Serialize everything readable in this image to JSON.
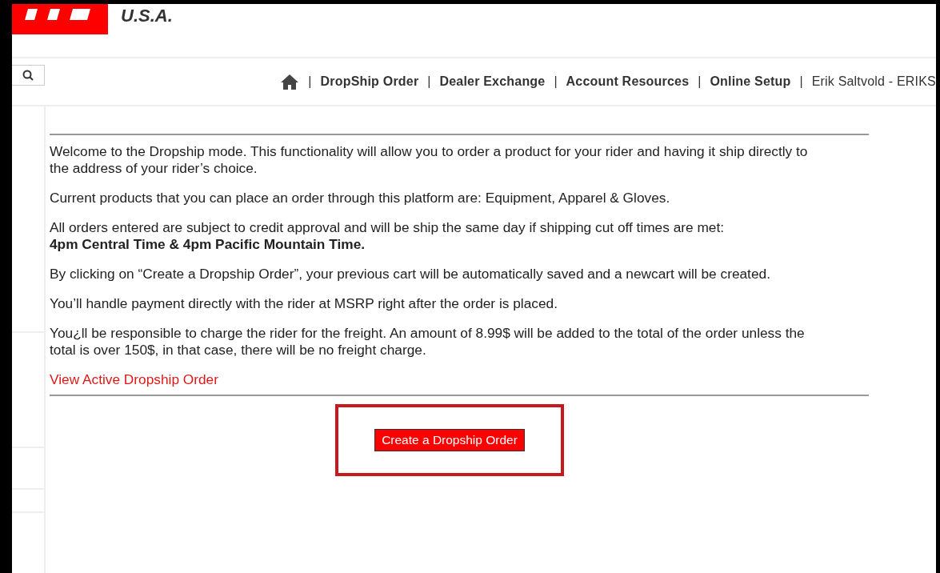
{
  "header": {
    "region": "U.S.A."
  },
  "nav": {
    "separator": "|",
    "items": [
      {
        "label": "DropShip Order",
        "kind": "link"
      },
      {
        "label": "Dealer Exchange",
        "kind": "link"
      },
      {
        "label": "Account Resources",
        "kind": "link"
      },
      {
        "label": "Online Setup",
        "kind": "link"
      },
      {
        "label": "Erik Saltvold - ERIKS",
        "kind": "user"
      }
    ]
  },
  "paragraphs": [
    "Welcome to the Dropship mode. This functionality will allow you to order a product for your rider and having it ship directly to the address of your rider’s choice.",
    "Current products that you can place an order through this platform are: Equipment, Apparel & Gloves.",
    "All orders entered are subject to credit approval and will be ship the same day if shipping cut off times are met:\n**4pm Central Time & 4pm Pacific Mountain Time.**",
    "By clicking on “Create a Dropship Order”, your previous cart will be automatically saved and a newcart will be created.",
    "You’ll handle payment directly with the rider at MSRP right after the order is placed.",
    "You¿ll be responsible to charge the rider for the freight. An amount of 8.99$ will be added to the total of the order unless the total is over 150$, in that case, there will be no freight charge."
  ],
  "active_link": "View Active Dropship Order",
  "create_button": {
    "label": "Create a Dropship Order",
    "highlighted": true
  }
}
